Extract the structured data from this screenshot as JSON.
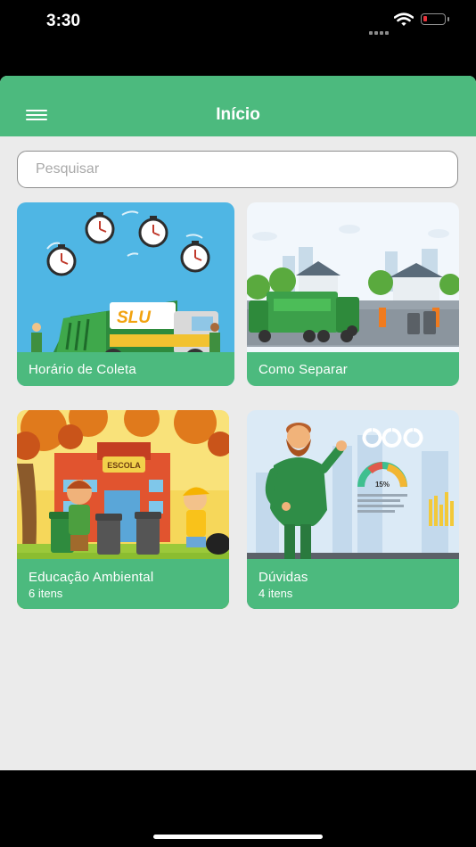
{
  "status_bar": {
    "time": "3:30"
  },
  "header": {
    "title": "Início"
  },
  "search": {
    "placeholder": "Pesquisar"
  },
  "cards": [
    {
      "title": "Horário de Coleta",
      "subtitle": ""
    },
    {
      "title": "Como Separar",
      "subtitle": ""
    },
    {
      "title": "Educação Ambiental",
      "subtitle": "6 itens"
    },
    {
      "title": "Dúvidas",
      "subtitle": "4 itens"
    }
  ],
  "illustration_text": {
    "truck_logo": "SLU",
    "school_sign": "ESCOLA",
    "gauge_percent": "15%"
  },
  "colors": {
    "accent": "#4cba7e",
    "background": "#ebebeb"
  },
  "icons": [
    "menu-icon",
    "wifi-icon",
    "battery-icon",
    "signal-icon"
  ]
}
